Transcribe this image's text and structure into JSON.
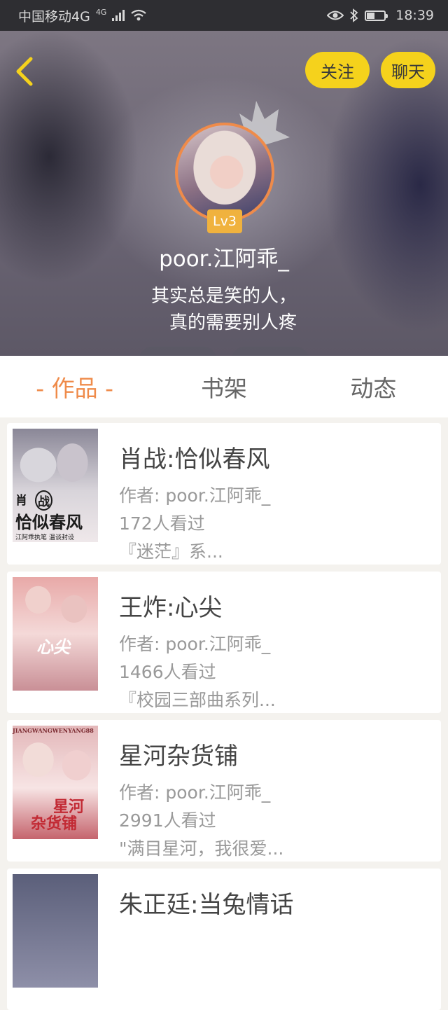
{
  "status_bar": {
    "carrier": "中国移动4G",
    "network": "4G",
    "time": "18:39"
  },
  "header": {
    "follow_label": "关注",
    "chat_label": "聊天",
    "level": "Lv3",
    "username": "poor.江阿乖_",
    "bio_line1": "其实总是笑的人，",
    "bio_line2": "真的需要别人疼"
  },
  "tabs": [
    {
      "label": "- 作品 -",
      "active": true
    },
    {
      "label": "书架",
      "active": false
    },
    {
      "label": "动态",
      "active": false
    }
  ],
  "works": [
    {
      "title": "肖战:恰似春风",
      "author": "作者: poor.江阿乖_",
      "views": "172人看过",
      "excerpt": "『迷茫』系...",
      "cover_text": [
        "肖",
        "战",
        "恰似春风",
        "江阿乖执笔  温谈封设"
      ]
    },
    {
      "title": "王炸:心尖",
      "author": "作者: poor.江阿乖_",
      "views": "1466人看过",
      "excerpt": "『校园三部曲系列...",
      "cover_text": [
        "心尖"
      ]
    },
    {
      "title": "星河杂货铺",
      "author": "作者: poor.江阿乖_",
      "views": "2991人看过",
      "excerpt": "\"满目星河，我很爱...",
      "cover_text": [
        "JIANGWANGWENYANG88",
        "星河",
        "杂货铺"
      ]
    },
    {
      "title": "朱正廷:当兔情话",
      "author": "",
      "views": "",
      "excerpt": "",
      "cover_text": []
    }
  ],
  "colors": {
    "accent": "#ef8b4a",
    "button_yellow": "#f5d21c",
    "level_badge": "#f0b23e"
  }
}
